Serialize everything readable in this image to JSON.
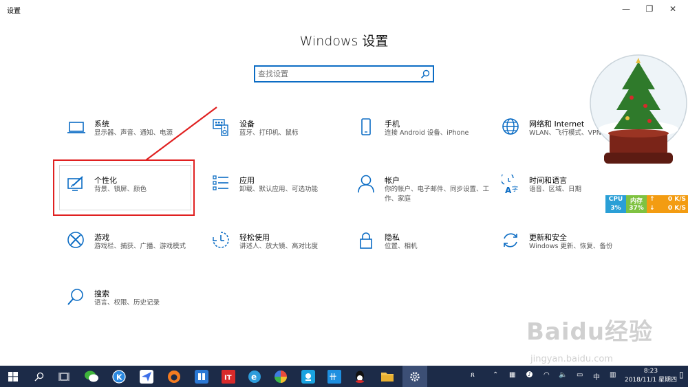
{
  "window": {
    "title": "设置",
    "minimize_glyph": "—",
    "maximize_glyph": "❐",
    "close_glyph": "✕"
  },
  "heading": "Windows 设置",
  "search": {
    "placeholder": "查找设置"
  },
  "settings": [
    {
      "name": "系统",
      "desc": "显示器、声音、通知、电源",
      "icon": "laptop-icon"
    },
    {
      "name": "设备",
      "desc": "蓝牙、打印机、鼠标",
      "icon": "devices-icon"
    },
    {
      "name": "手机",
      "desc": "连接 Android 设备、iPhone",
      "icon": "phone-icon"
    },
    {
      "name": "网络和 Internet",
      "desc": "WLAN、飞行模式、VPN",
      "icon": "globe-icon"
    },
    {
      "name": "个性化",
      "desc": "背景、锁屏、颜色",
      "icon": "personalize-icon"
    },
    {
      "name": "应用",
      "desc": "卸载、默认应用、可选功能",
      "icon": "apps-list-icon"
    },
    {
      "name": "帐户",
      "desc": "你的帐户、电子邮件、同步设置、工作、家庭",
      "icon": "person-icon"
    },
    {
      "name": "时间和语言",
      "desc": "语音、区域、日期",
      "icon": "time-language-icon"
    },
    {
      "name": "游戏",
      "desc": "游戏栏、捕获、广播、游戏模式",
      "icon": "xbox-icon"
    },
    {
      "name": "轻松使用",
      "desc": "讲述人、放大镜、高对比度",
      "icon": "ease-of-access-icon"
    },
    {
      "name": "隐私",
      "desc": "位置、相机",
      "icon": "lock-icon"
    },
    {
      "name": "更新和安全",
      "desc": "Windows 更新、恢复、备份",
      "icon": "sync-icon"
    },
    {
      "name": "搜索",
      "desc": "语言、权限、历史记录",
      "icon": "search-icon"
    }
  ],
  "monitor": {
    "cpu_label": "CPU",
    "cpu_value": "3%",
    "mem_label": "内存",
    "mem_value": "37%",
    "up_label": "0 K/S",
    "down_label": "0 K/S"
  },
  "taskbar": {
    "clock_time": "8:23",
    "clock_date": "2018/11/1 星期四",
    "ime_label": "中",
    "tray_person": "ጸ",
    "colors": {
      "bg": "#1c2b48",
      "active": "#3c4f75"
    }
  },
  "watermark": {
    "line1": "Baidu经验",
    "line2": "jingyan.baidu.com"
  },
  "colors": {
    "accent": "#0b6cc4",
    "highlight": "#e02020"
  }
}
